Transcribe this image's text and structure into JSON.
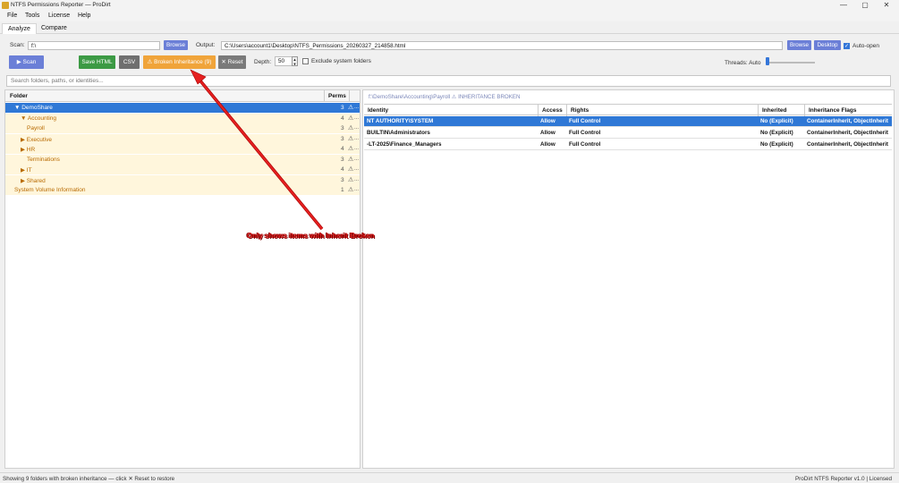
{
  "window": {
    "title": "NTFS Permissions Reporter — ProDirt",
    "controls": [
      "—",
      "▢",
      "✕"
    ]
  },
  "menu": [
    "File",
    "Tools",
    "License",
    "Help"
  ],
  "tabs": [
    {
      "label": "Analyze",
      "active": true
    },
    {
      "label": "Compare",
      "active": false
    }
  ],
  "scan": {
    "label": "Scan:",
    "value": "f:\\",
    "browse_label": "Browse"
  },
  "output": {
    "label": "Output:",
    "value": "C:\\Users\\account1\\Desktop\\NTFS_Permissions_20260327_214858.html",
    "browse_label": "Browse",
    "desktop_label": "Desktop",
    "auto_open_label": "Auto-open",
    "auto_open_checked": true
  },
  "actions": {
    "scan_label": "▶ Scan",
    "save_html_label": "Save HTML",
    "csv_label": "CSV",
    "broken_label": "⚠ Broken Inheritance (9)",
    "reset_label": "✕ Reset"
  },
  "depth": {
    "label": "Depth:",
    "value": "50"
  },
  "exclude_system": {
    "label": "Exclude system folders",
    "checked": false
  },
  "threads": {
    "label": "Threads: Auto"
  },
  "search": {
    "placeholder": "Search folders, paths, or identities..."
  },
  "tree": {
    "col_folder": "Folder",
    "col_perms": "Perms",
    "rows": [
      {
        "label": "▼ DemoShare",
        "indent": 0,
        "count": "3",
        "selected": true
      },
      {
        "label": "▼ Accounting",
        "indent": 1,
        "count": "4",
        "selected": false
      },
      {
        "label": "Payroll",
        "indent": 2,
        "count": "3",
        "selected": false
      },
      {
        "label": "▶ Executive",
        "indent": 1,
        "count": "3",
        "selected": false
      },
      {
        "label": "▶ HR",
        "indent": 1,
        "count": "4",
        "selected": false
      },
      {
        "label": "Terminations",
        "indent": 2,
        "count": "3",
        "selected": false
      },
      {
        "label": "▶ IT",
        "indent": 1,
        "count": "4",
        "selected": false
      },
      {
        "label": "▶ Shared",
        "indent": 1,
        "count": "3",
        "selected": false
      },
      {
        "label": "System Volume Information",
        "indent": 0,
        "count": "1",
        "selected": false
      }
    ],
    "warn_glyph": "⚠",
    "dots": "..."
  },
  "detail": {
    "breadcrumb": "f:\\DemoShare\\Accounting\\Payroll  ⚠ INHERITANCE BROKEN",
    "headers": [
      "Identity",
      "Access",
      "Rights",
      "Inherited",
      "Inheritance Flags"
    ],
    "rows": [
      {
        "identity": "NT AUTHORITY\\SYSTEM",
        "access": "Allow",
        "rights": "Full Control",
        "inherited": "No (Explicit)",
        "flags": "ContainerInherit, ObjectInherit",
        "selected": true
      },
      {
        "identity": "BUILTIN\\Administrators",
        "access": "Allow",
        "rights": "Full Control",
        "inherited": "No (Explicit)",
        "flags": "ContainerInherit, ObjectInherit",
        "selected": false
      },
      {
        "identity": "-LT-2025\\Finance_Managers",
        "access": "Allow",
        "rights": "Full Control",
        "inherited": "No (Explicit)",
        "flags": "ContainerInherit, ObjectInherit",
        "selected": false
      }
    ]
  },
  "annotation": {
    "text": "Only shows items with Inherit Broken",
    "color": "#d81818"
  },
  "status": {
    "left": "Showing 9 folders with broken inheritance — click ✕ Reset to restore",
    "right": "ProDirt NTFS Reporter v1.0  |  Licensed"
  },
  "colors": {
    "accent": "#6b7fd7",
    "selection": "#2f78d6",
    "broken_row": "#fff6dc",
    "broken_text": "#b86a00",
    "save_green": "#3c9a44",
    "broken_orange": "#f0a43a"
  }
}
